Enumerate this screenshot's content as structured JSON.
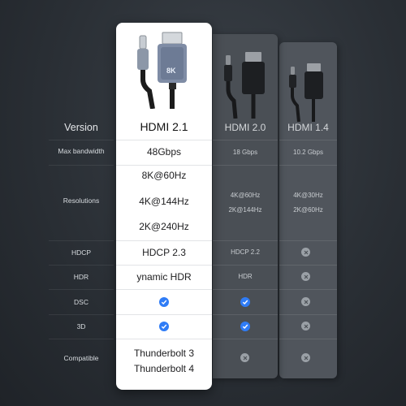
{
  "rows": {
    "version": "Version",
    "max_bandwidth": "Max bandwidth",
    "resolutions": "Resolutions",
    "hdcp": "HDCP",
    "hdr": "HDR",
    "dsc": "DSC",
    "three_d": "3D",
    "compatible": "Compatible"
  },
  "main": {
    "cable_label": "8K",
    "version": "HDMI 2.1",
    "bandwidth": "48Gbps",
    "res1": "8K@60Hz",
    "res2": "4K@144Hz",
    "res3": "2K@240Hz",
    "hdcp": "HDCP 2.3",
    "hdr": "ynamic HDR",
    "dsc_icon": "check-icon",
    "three_d_icon": "check-icon",
    "compat1": "Thunderbolt 3",
    "compat2": "Thunderbolt 4"
  },
  "hdmi20": {
    "version": "HDMI 2.0",
    "bandwidth": "18 Gbps",
    "res1": "4K@60Hz",
    "res2": "2K@144Hz",
    "hdcp": "HDCP 2.2",
    "hdr": "HDR",
    "dsc_icon": "check-icon",
    "three_d_icon": "check-icon",
    "compatible_icon": "x-icon"
  },
  "hdmi14": {
    "version": "HDMI 1.4",
    "bandwidth": "10.2 Gbps",
    "res1": "4K@30Hz",
    "res2": "2K@60Hz",
    "hdcp_icon": "x-icon",
    "hdr_icon": "x-icon",
    "dsc_icon": "x-icon",
    "three_d_icon": "x-icon",
    "compatible_icon": "x-icon"
  },
  "colors": {
    "check": "#2f7cf6",
    "x": "#9aa0a6",
    "background": "#2a2f35",
    "highlight_column": "#ffffff"
  }
}
